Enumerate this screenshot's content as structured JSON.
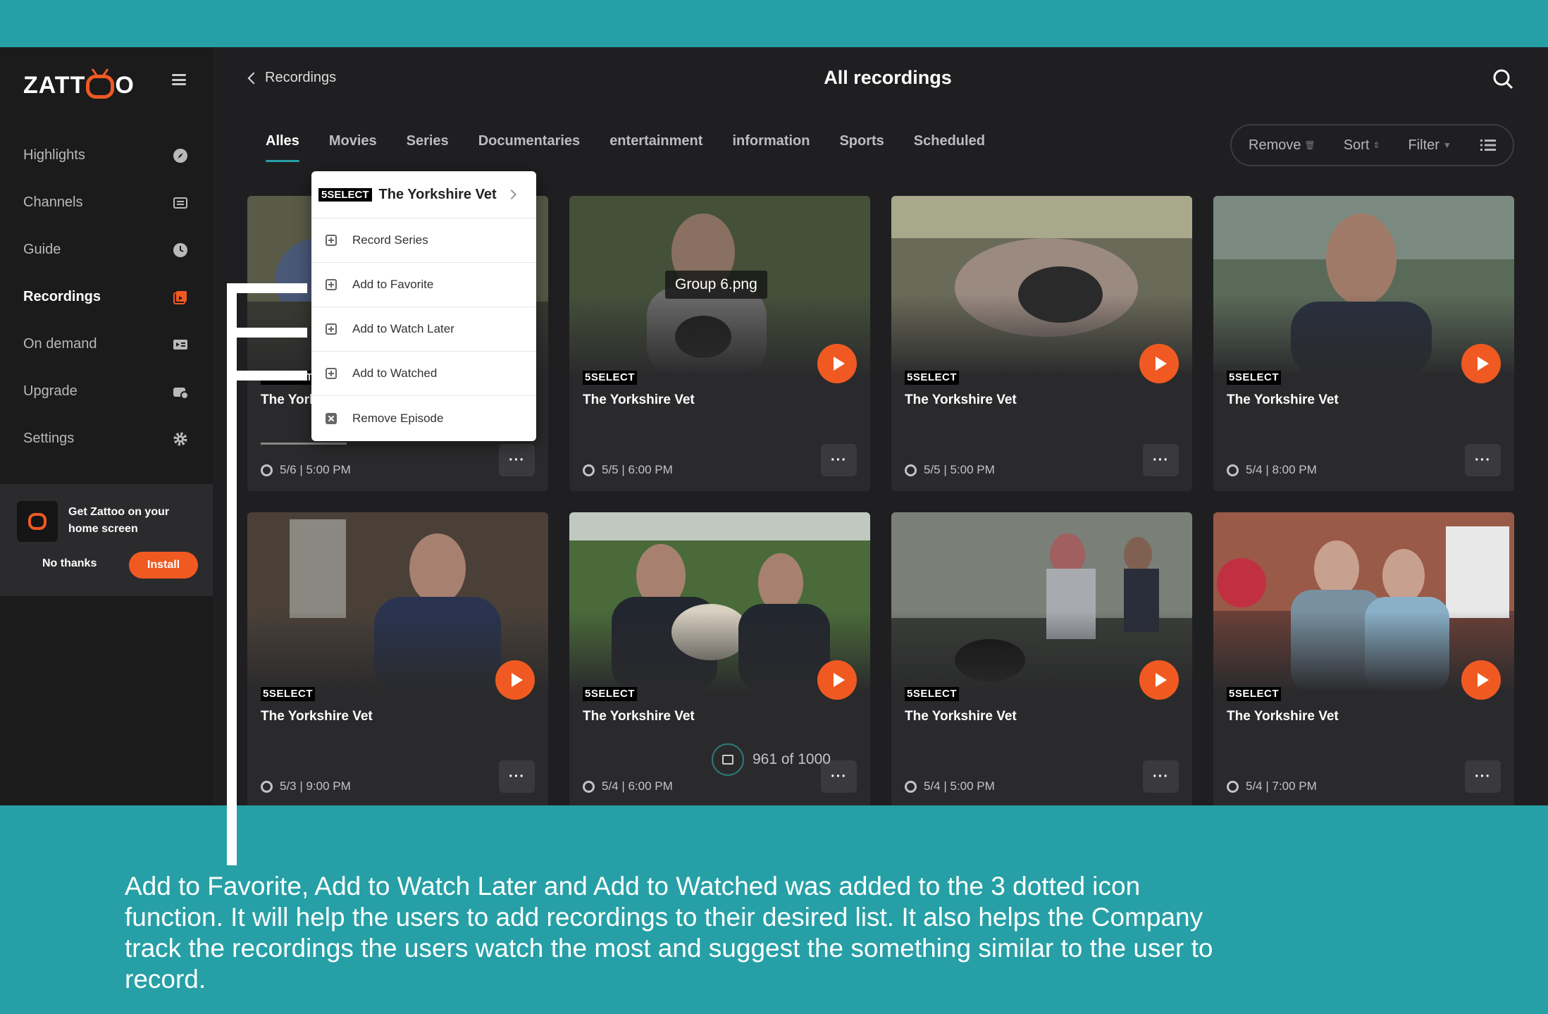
{
  "app": {
    "logo_text": "ZATTOO"
  },
  "sidebar": {
    "items": [
      {
        "label": "Highlights",
        "icon": "compass-icon",
        "active": false
      },
      {
        "label": "Channels",
        "icon": "channels-icon",
        "active": false
      },
      {
        "label": "Guide",
        "icon": "clock-icon",
        "active": false
      },
      {
        "label": "Recordings",
        "icon": "recordings-icon",
        "active": true
      },
      {
        "label": "On demand",
        "icon": "ondemand-icon",
        "active": false
      },
      {
        "label": "Upgrade",
        "icon": "upgrade-icon",
        "active": false
      },
      {
        "label": "Settings",
        "icon": "gear-icon",
        "active": false
      }
    ],
    "promo": {
      "text": "Get Zattoo on your home screen",
      "no_thanks": "No thanks",
      "install": "Install"
    }
  },
  "header": {
    "back_label": "Recordings",
    "title": "All recordings"
  },
  "tabs": [
    "Alles",
    "Movies",
    "Series",
    "Documentaries",
    "entertainment",
    "information",
    "Sports",
    "Scheduled"
  ],
  "toolbar": {
    "remove": "Remove",
    "sort": "Sort",
    "filter": "Filter"
  },
  "cards": [
    {
      "channel": "5SELECT",
      "title": "The Yorkshire Vet",
      "datetime": "5/6 | 5:00 PM"
    },
    {
      "channel": "5SELECT",
      "title": "The Yorkshire Vet",
      "datetime": "5/5 | 6:00 PM"
    },
    {
      "channel": "5SELECT",
      "title": "The Yorkshire Vet",
      "datetime": "5/5 | 5:00 PM"
    },
    {
      "channel": "5SELECT",
      "title": "The Yorkshire Vet",
      "datetime": "5/4 | 8:00 PM"
    },
    {
      "channel": "5SELECT",
      "title": "The Yorkshire Vet",
      "datetime": "5/3 | 9:00 PM"
    },
    {
      "channel": "5SELECT",
      "title": "The Yorkshire Vet",
      "datetime": "5/4 | 6:00 PM"
    },
    {
      "channel": "5SELECT",
      "title": "The Yorkshire Vet",
      "datetime": "5/4 | 5:00 PM"
    },
    {
      "channel": "5SELECT",
      "title": "The Yorkshire Vet",
      "datetime": "5/4 | 7:00 PM"
    }
  ],
  "more_label": "···",
  "context_menu": {
    "channel": "5SELECT",
    "title": "The Yorkshire Vet",
    "items": [
      "Record Series",
      "Add to Favorite",
      "Add to Watch Later",
      "Add to Watched",
      "Remove Episode"
    ]
  },
  "tooltip": "Group 6.png",
  "recordings_count": "961 of 1000",
  "caption": "Add to Favorite, Add to Watch Later and Add to Watched was added to the 3 dotted icon function. It will help the users to add recordings to their desired list. It also helps the Company track the recordings the users watch the most and suggest the something similar to the user to record.",
  "colors": {
    "accent": "#f05a22",
    "teal": "#26a0a6",
    "background": "#1f1f21"
  }
}
